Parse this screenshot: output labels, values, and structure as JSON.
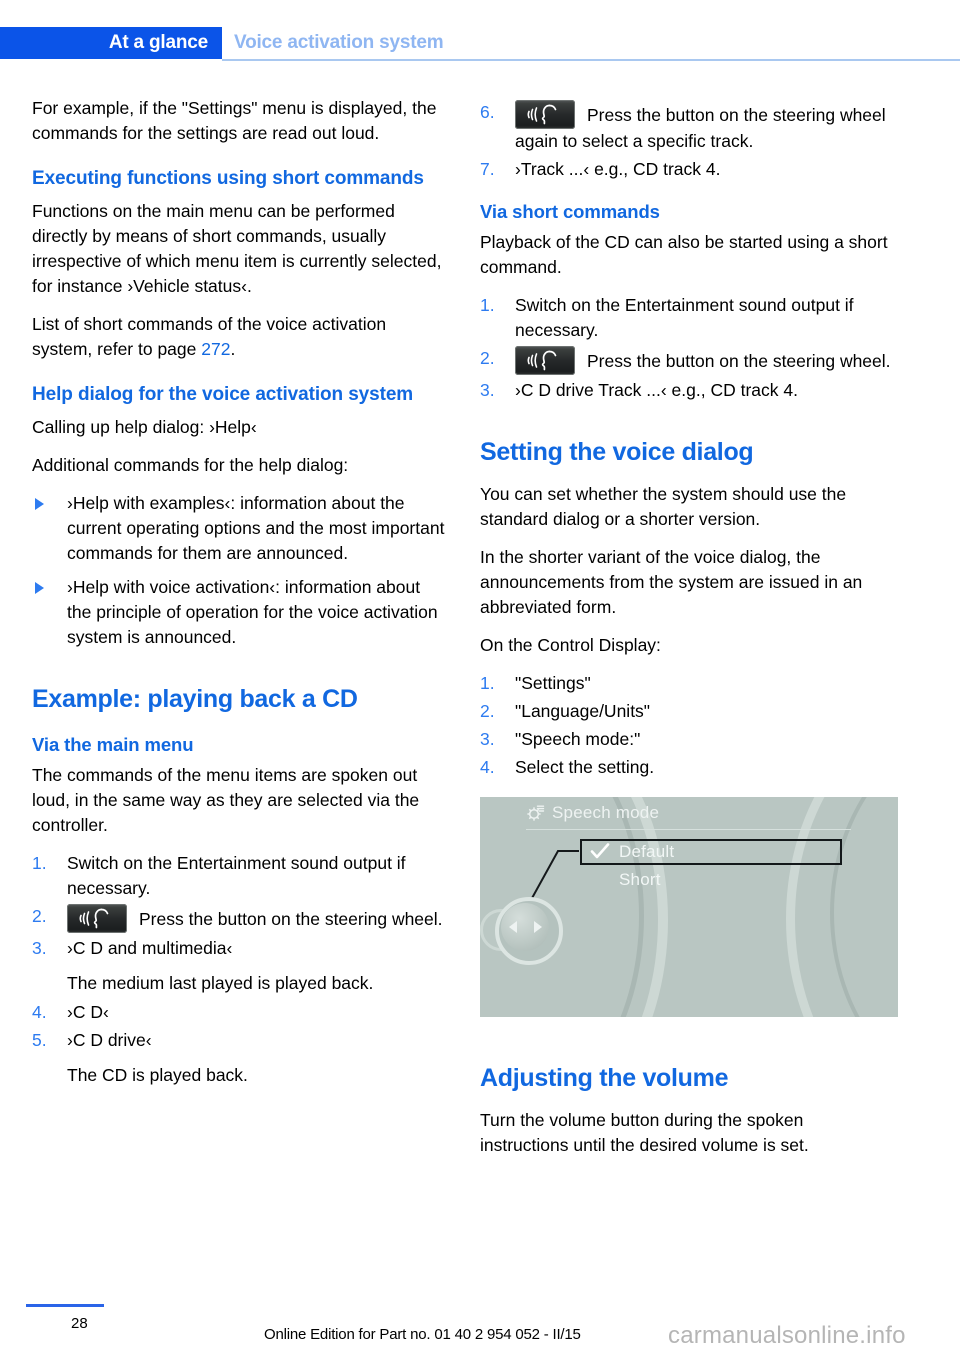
{
  "header": {
    "tab_label": "At a glance",
    "chapter_label": "Voice activation system"
  },
  "colors": {
    "accent_blue": "#1168e0",
    "tab_blue": "#0b54e8",
    "chapter_light_blue": "#8fb6f2",
    "list_number_blue": "#2d7bf0"
  },
  "left_column": {
    "intro_paragraph": "For example, if the \"Settings\" menu is displayed, the commands for the settings are read out loud.",
    "heading_short_commands": "Executing functions using short commands",
    "short_commands_p1": "Functions on the main menu can be performed directly by means of short commands, usually irrespective of which menu item is currently selected, for instance ›Vehicle status‹.",
    "short_commands_p2_before": "List of short commands of the voice activation system, refer to page ",
    "short_commands_p2_pageref": "272",
    "short_commands_p2_after": ".",
    "heading_help_dialog": "Help dialog for the voice activation system",
    "help_p1": "Calling up help dialog: ›Help‹",
    "help_p2": "Additional commands for the help dialog:",
    "help_bullets": [
      "›Help with examples‹: information about the current operating options and the most important commands for them are announced.",
      "›Help with voice activation‹: information about the principle of operation for the voice activation system is announced."
    ],
    "heading_example_cd": "Example: playing back a CD",
    "heading_via_main_menu": "Via the main menu",
    "via_main_menu_intro": "The commands of the menu items are spoken out loud, in the same way as they are selected via the controller.",
    "steps": [
      {
        "num": "1.",
        "text": "Switch on the Entertainment sound output if necessary.",
        "icon": null
      },
      {
        "num": "2.",
        "text": "Press the button on the steering wheel.",
        "icon": "voice-button-icon"
      },
      {
        "num": "3.",
        "text": "›C D and multimedia‹",
        "icon": null,
        "continuation": "The medium last played is played back."
      },
      {
        "num": "4.",
        "text": "›C D‹",
        "icon": null
      },
      {
        "num": "5.",
        "text": "›C D drive‹",
        "icon": null,
        "continuation": "The CD is played back."
      }
    ]
  },
  "right_column": {
    "steps_continued": [
      {
        "num": "6.",
        "text": "Press the button on the steering wheel again to select a specific track.",
        "icon": "voice-button-icon"
      },
      {
        "num": "7.",
        "text": "›Track ...‹ e.g., CD track 4.",
        "icon": null
      }
    ],
    "heading_via_short_commands": "Via short commands",
    "via_short_commands_intro": "Playback of the CD can also be started using a short command.",
    "short_command_steps": [
      {
        "num": "1.",
        "text": "Switch on the Entertainment sound output if necessary.",
        "icon": null
      },
      {
        "num": "2.",
        "text": "Press the button on the steering wheel.",
        "icon": "voice-button-icon"
      },
      {
        "num": "3.",
        "text": "›C D drive Track ...‹ e.g., CD track 4.",
        "icon": null
      }
    ],
    "heading_setting_voice_dialog": "Setting the voice dialog",
    "setting_p1": "You can set whether the system should use the standard dialog or a shorter version.",
    "setting_p2": "In the shorter variant of the voice dialog, the announcements from the system are issued in an abbreviated form.",
    "setting_p3": "On the Control Display:",
    "setting_steps": [
      {
        "num": "1.",
        "text": "\"Settings\""
      },
      {
        "num": "2.",
        "text": "\"Language/Units\""
      },
      {
        "num": "3.",
        "text": "\"Speech mode:\""
      },
      {
        "num": "4.",
        "text": "Select the setting."
      }
    ],
    "figure": {
      "title": "Speech mode",
      "option_selected": "Default",
      "option_other": "Short",
      "gear_icon": "gear-icon",
      "check_icon": "check-icon"
    },
    "heading_adjusting_volume": "Adjusting the volume",
    "adjusting_volume_text": "Turn the volume button during the spoken instructions until the desired volume is set."
  },
  "footer": {
    "page_number": "28",
    "edition_text": "Online Edition for Part no. 01 40 2 954 052 - II/15",
    "watermark": "carmanualsonline.info"
  }
}
